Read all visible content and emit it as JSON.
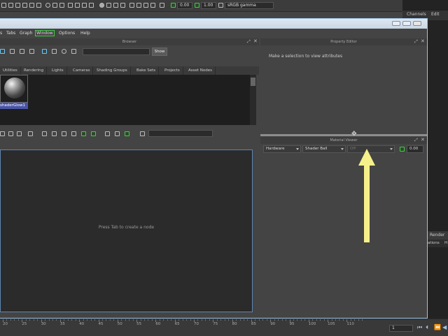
{
  "top_toolbar": {
    "exposure_value": "0.00",
    "gamma_value": "1.00",
    "colorspace": "sRGB gamma"
  },
  "right_panel": {
    "channels_label": "Channels",
    "edit_label": "Edit",
    "render_label": "Render",
    "options_fragment": "ations",
    "h_fragment": "H"
  },
  "menubar": {
    "items": [
      "s",
      "Tabs",
      "Graph",
      "Window",
      "Options",
      "Help"
    ]
  },
  "browser": {
    "title": "Browser",
    "show_button": "Show",
    "tabs": [
      "Utilities",
      "Rendering",
      "Lights",
      "Cameras",
      "Shading Groups",
      "Bake Sets",
      "Projects",
      "Asset Nodes"
    ],
    "swatch_label": "shaderGlow1"
  },
  "node_editor": {
    "hint": "Press Tab to create a node"
  },
  "property_editor": {
    "title": "Property Editor",
    "message": "Make a selection to view attributes"
  },
  "material_viewer": {
    "title": "Material Viewer",
    "renderer": "Hardware",
    "geometry": "Shader Ball",
    "mode": "Off",
    "value": "0.00"
  },
  "timeline": {
    "ticks": [
      "20",
      "25",
      "30",
      "35",
      "40",
      "45",
      "50",
      "55",
      "60",
      "65",
      "70",
      "75",
      "80",
      "85",
      "90",
      "95",
      "100",
      "105",
      "110"
    ],
    "current_frame": "1"
  },
  "annotation": {
    "arrow_color": "#f6f08a"
  }
}
